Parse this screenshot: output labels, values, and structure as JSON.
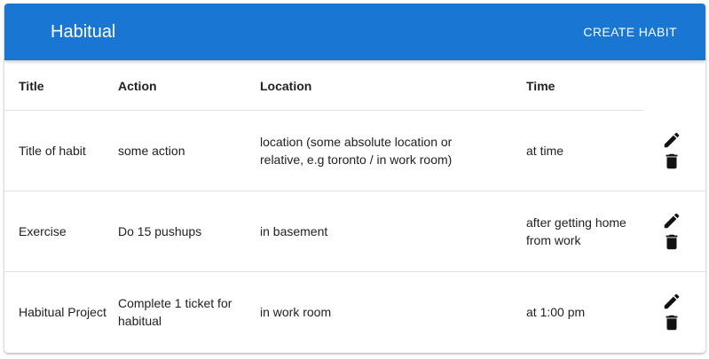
{
  "appbar": {
    "title": "Habitual",
    "create_label": "CREATE HABIT",
    "color": "#1976d2"
  },
  "table": {
    "headers": {
      "title": "Title",
      "action": "Action",
      "location": "Location",
      "time": "Time"
    },
    "rows": [
      {
        "title": "Title of habit",
        "action": "some action",
        "location": "location (some absolute location or relative, e.g toronto / in work room)",
        "time": "at time"
      },
      {
        "title": "Exercise",
        "action": "Do 15 pushups",
        "location": "in basement",
        "time": "after getting home from work"
      },
      {
        "title": "Habitual Project",
        "action": "Complete 1 ticket for habitual",
        "location": "in work room",
        "time": "at 1:00 pm"
      }
    ],
    "row_icons": [
      "edit-icon",
      "delete-icon"
    ]
  }
}
